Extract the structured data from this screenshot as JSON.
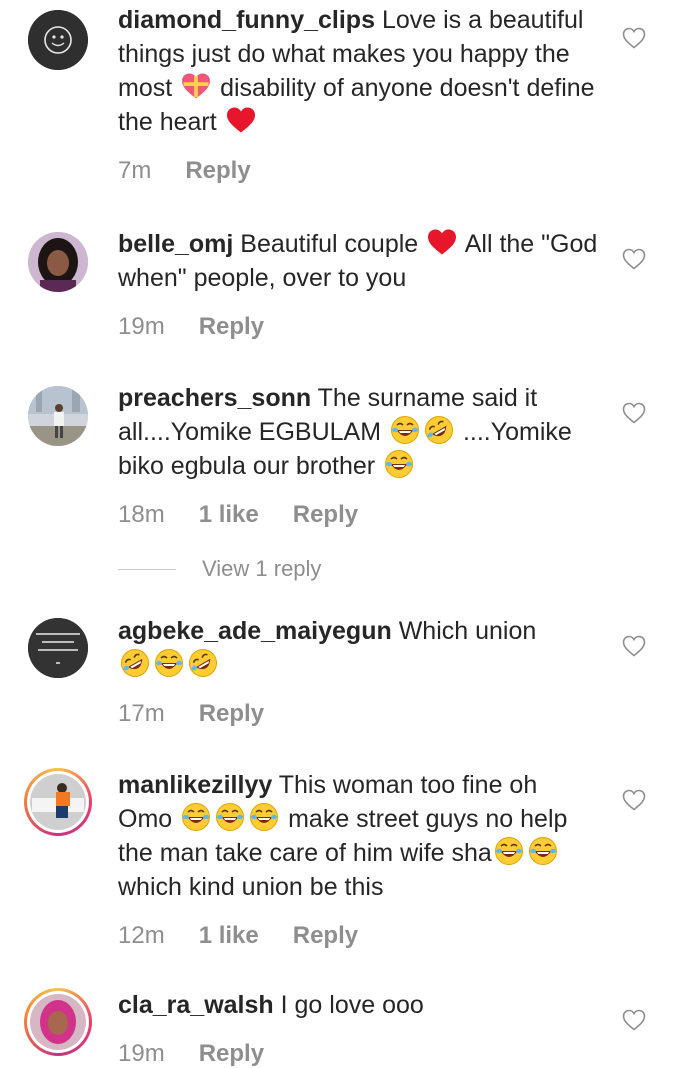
{
  "comments": [
    {
      "username": "diamond_funny_clips",
      "text_parts": [
        "Love is a beautiful things just do what makes you happy the most",
        "disability of anyone doesn't define the heart"
      ],
      "time": "7m",
      "likes": "",
      "reply": "Reply"
    },
    {
      "username": "belle_omj",
      "text_parts": [
        "Beautiful couple",
        "All the \"God when\" people, over to you"
      ],
      "time": "19m",
      "likes": "",
      "reply": "Reply"
    },
    {
      "username": "preachers_sonn",
      "text_parts": [
        "The surname said it all....Yomike EGBULAM",
        "....Yomike biko egbula our brother"
      ],
      "time": "18m",
      "likes": "1 like",
      "reply": "Reply"
    },
    {
      "username": "agbeke_ade_maiyegun",
      "text_parts": [
        "Which union"
      ],
      "time": "17m",
      "likes": "",
      "reply": "Reply"
    },
    {
      "username": "manlikezillyy",
      "text_parts": [
        "This woman too fine oh Omo",
        "make street guys no help the man take care of him wife sha",
        "which kind union be this"
      ],
      "time": "12m",
      "likes": "1 like",
      "reply": "Reply"
    },
    {
      "username": "cla_ra_walsh",
      "text_parts": [
        "I go love ooo"
      ],
      "time": "19m",
      "likes": "",
      "reply": "Reply"
    }
  ],
  "view_reply": "View 1 reply",
  "icons": {
    "like": "heart-outline-icon",
    "love": "red-heart-emoji",
    "gift": "heart-gift-emoji",
    "laugh": "tears-of-joy-emoji",
    "rofl": "rolling-laugh-emoji"
  },
  "colors": {
    "text": "#262626",
    "muted": "#8e8e8e",
    "red_heart": "#e8162a"
  }
}
